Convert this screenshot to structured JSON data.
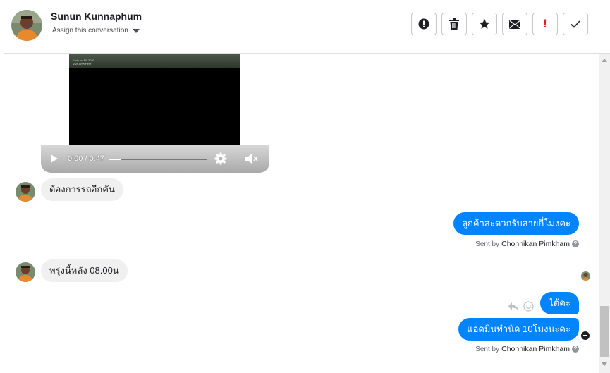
{
  "header": {
    "contact_name": "Sunun Kunnaphum",
    "assign_label": "Assign this conversation",
    "toolbar": [
      {
        "icon": "alert-circle-icon",
        "name": "mark-spam-button"
      },
      {
        "icon": "trash-icon",
        "name": "delete-button"
      },
      {
        "icon": "star-icon",
        "name": "star-button"
      },
      {
        "icon": "envelope-icon",
        "name": "mark-unread-button"
      },
      {
        "icon": "exclamation-icon",
        "name": "mark-important-button"
      },
      {
        "icon": "checkmark-icon",
        "name": "mark-done-button"
      }
    ]
  },
  "video": {
    "frame_text_line1": "Ends on FB 2020",
    "frame_text_line2": "Viva Anywhere",
    "time": "0:00 / 0:47",
    "progress": 0.0
  },
  "messages": [
    {
      "direction": "in",
      "text": "ต้องการรถอีกคัน"
    },
    {
      "direction": "out",
      "text": "ลูกค้าสะดวกรับสายกี่โมงคะ",
      "sent_by_prefix": "Sent by",
      "sent_by_name": "Chonnikan Pimkham"
    },
    {
      "direction": "in",
      "text": "พรุ่งนี้หลัง 08.00น"
    },
    {
      "direction": "out",
      "text": "ได้คะ"
    },
    {
      "direction": "out",
      "text": "แอดมินทำนัด 10โมงนะคะ",
      "sent_by_prefix": "Sent by",
      "sent_by_name": "Chonnikan Pimkham"
    }
  ],
  "colors": {
    "outgoing_bubble": "#0084ff",
    "incoming_bubble": "#f1f0f0",
    "important_red": "#e02020"
  }
}
